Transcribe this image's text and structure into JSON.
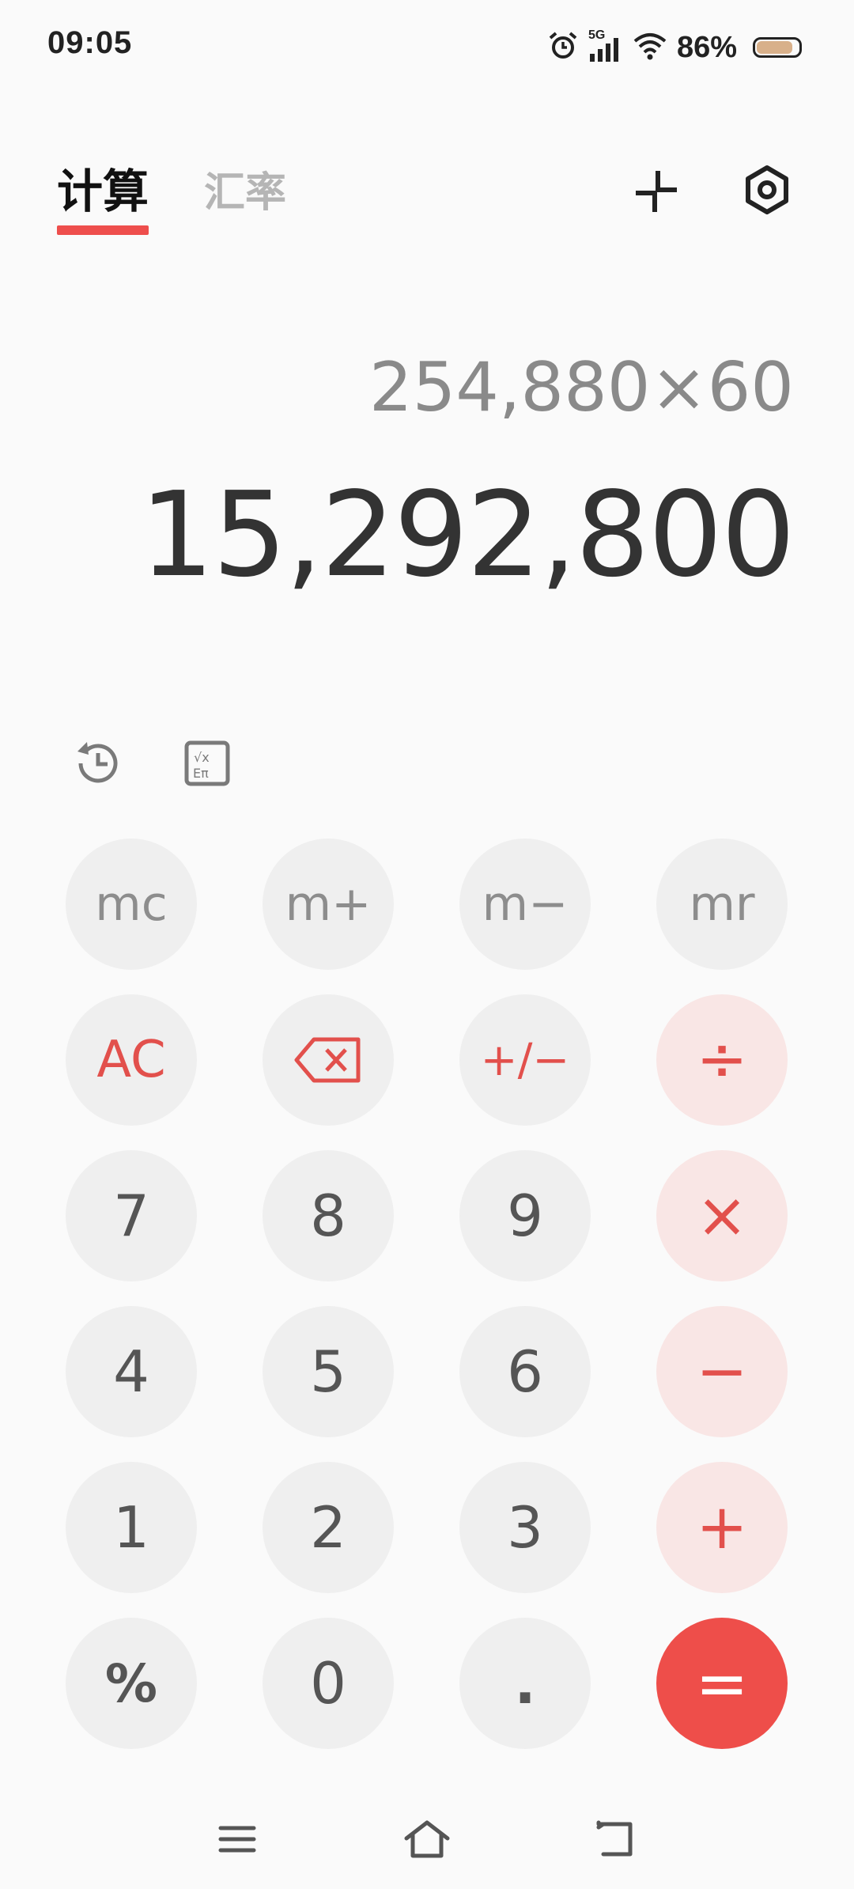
{
  "status": {
    "time": "09:05",
    "network": "5G",
    "battery": "86%",
    "battery_level": 0.86
  },
  "tabs": [
    {
      "label": "计算",
      "active": true
    },
    {
      "label": "汇率",
      "active": false
    }
  ],
  "display": {
    "expression": "254,880×60",
    "result": "15,292,800"
  },
  "keys": {
    "mc": "mc",
    "m_plus": "m+",
    "m_minus": "m−",
    "mr": "mr",
    "ac": "AC",
    "plus_minus": "+/−",
    "divide": "÷",
    "seven": "7",
    "eight": "8",
    "nine": "9",
    "multiply": "×",
    "four": "4",
    "five": "5",
    "six": "6",
    "minus": "−",
    "one": "1",
    "two": "2",
    "three": "3",
    "plus": "+",
    "percent": "%",
    "zero": "0",
    "dot": ".",
    "equals": "="
  },
  "icons": {
    "collapse": "collapse-icon",
    "settings": "settings-icon",
    "history": "history-icon",
    "scientific": "scientific-icon",
    "backspace": "backspace-icon",
    "menu": "menu-icon",
    "home": "home-icon",
    "back": "back-icon"
  },
  "colors": {
    "accent": "#ee4e4a",
    "op_bg": "#f9e6e5",
    "key_bg": "#efefef"
  }
}
